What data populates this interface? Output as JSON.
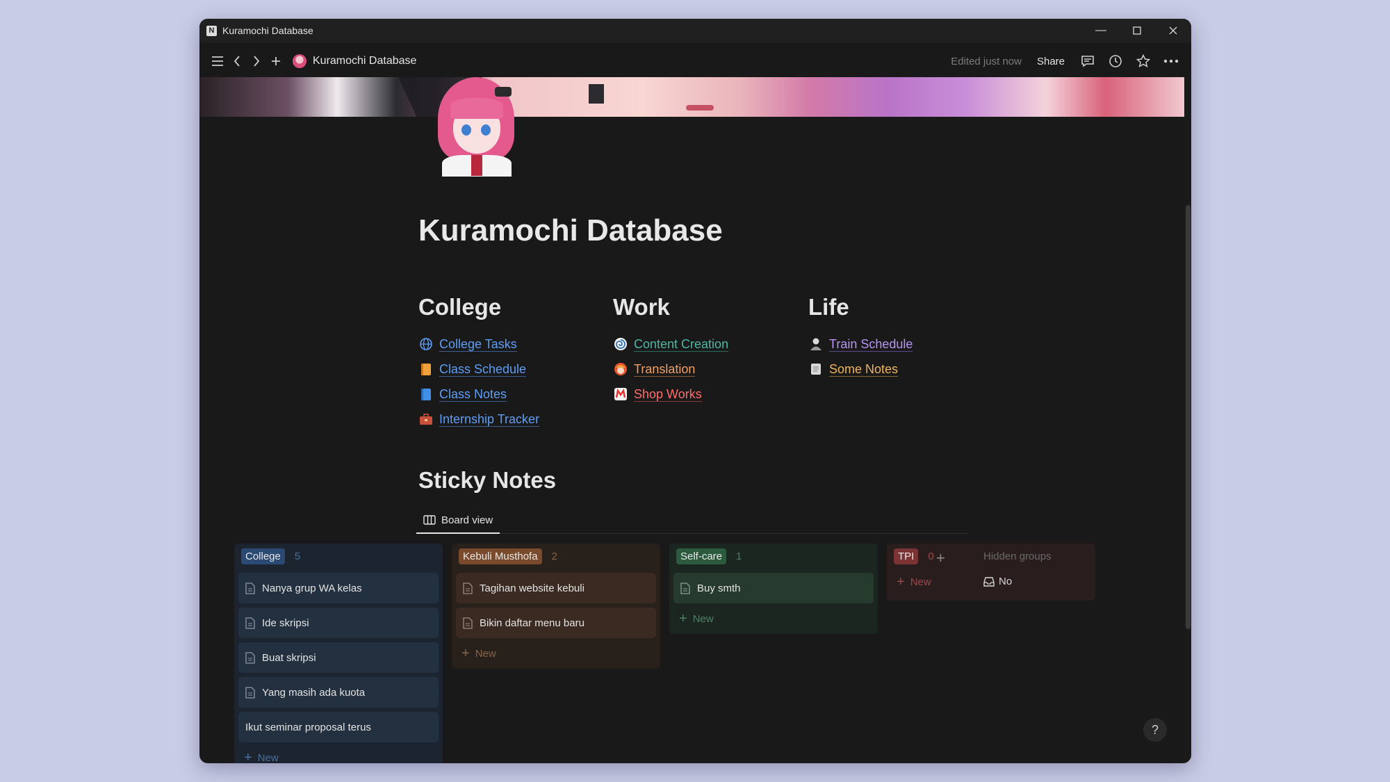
{
  "window": {
    "title": "Kuramochi Database",
    "app_icon_letter": "N"
  },
  "toolbar": {
    "page_name": "Kuramochi Database",
    "edited_status": "Edited just now",
    "share_label": "Share"
  },
  "page": {
    "title": "Kuramochi Database"
  },
  "sections": [
    {
      "heading": "College",
      "links": [
        {
          "label": "College Tasks",
          "icon": "globe-icon",
          "color": "#5e9ef5"
        },
        {
          "label": "Class Schedule",
          "icon": "notebook-orange-icon",
          "color": "#5e9ef5"
        },
        {
          "label": "Class Notes",
          "icon": "notebook-blue-icon",
          "color": "#5e9ef5"
        },
        {
          "label": "Internship Tracker",
          "icon": "briefcase-icon",
          "color": "#5e9ef5"
        }
      ]
    },
    {
      "heading": "Work",
      "links": [
        {
          "label": "Content Creation",
          "icon": "spiral-icon",
          "color": "#4fb8a4"
        },
        {
          "label": "Translation",
          "icon": "avatar-orange-icon",
          "color": "#f1a067"
        },
        {
          "label": "Shop Works",
          "icon": "shop-logo-icon",
          "color": "#ff6e6e"
        }
      ]
    },
    {
      "heading": "Life",
      "links": [
        {
          "label": "Train Schedule",
          "icon": "person-icon",
          "color": "#b794f6"
        },
        {
          "label": "Some Notes",
          "icon": "note-icon",
          "color": "#f0b560"
        }
      ]
    }
  ],
  "sticky": {
    "heading": "Sticky Notes",
    "view_tab": "Board view",
    "new_label": "New",
    "columns": [
      {
        "name": "College",
        "count": "5",
        "cards": [
          "Nanya grup WA kelas",
          "Ide skripsi",
          "Buat skripsi",
          "Yang masih ada kuota",
          "Ikut seminar proposal terus"
        ]
      },
      {
        "name": "Kebuli Musthofa",
        "count": "2",
        "cards": [
          "Tagihan website kebuli",
          "Bikin daftar menu baru"
        ]
      },
      {
        "name": "Self-care",
        "count": "1",
        "cards": [
          "Buy smth"
        ]
      },
      {
        "name": "TPI",
        "count": "0",
        "cards": []
      }
    ],
    "hidden_groups_label": "Hidden groups",
    "hidden_item_label": "No"
  },
  "help_label": "?"
}
